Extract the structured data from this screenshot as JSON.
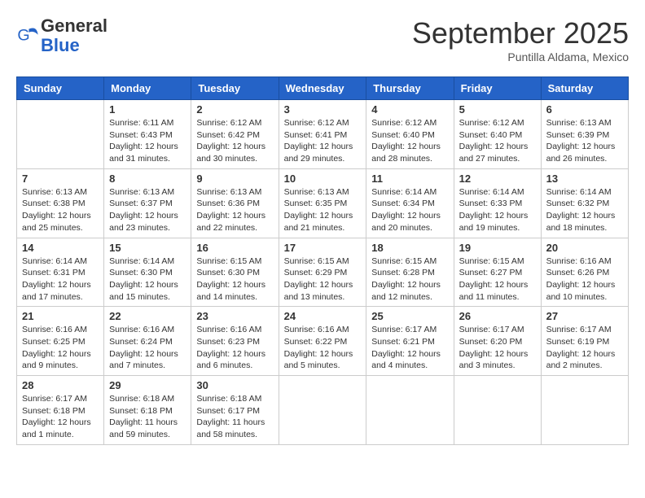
{
  "logo": {
    "general": "General",
    "blue": "Blue"
  },
  "header": {
    "month": "September 2025",
    "location": "Puntilla Aldama, Mexico"
  },
  "days_of_week": [
    "Sunday",
    "Monday",
    "Tuesday",
    "Wednesday",
    "Thursday",
    "Friday",
    "Saturday"
  ],
  "weeks": [
    [
      {
        "day": "",
        "info": ""
      },
      {
        "day": "1",
        "info": "Sunrise: 6:11 AM\nSunset: 6:43 PM\nDaylight: 12 hours\nand 31 minutes."
      },
      {
        "day": "2",
        "info": "Sunrise: 6:12 AM\nSunset: 6:42 PM\nDaylight: 12 hours\nand 30 minutes."
      },
      {
        "day": "3",
        "info": "Sunrise: 6:12 AM\nSunset: 6:41 PM\nDaylight: 12 hours\nand 29 minutes."
      },
      {
        "day": "4",
        "info": "Sunrise: 6:12 AM\nSunset: 6:40 PM\nDaylight: 12 hours\nand 28 minutes."
      },
      {
        "day": "5",
        "info": "Sunrise: 6:12 AM\nSunset: 6:40 PM\nDaylight: 12 hours\nand 27 minutes."
      },
      {
        "day": "6",
        "info": "Sunrise: 6:13 AM\nSunset: 6:39 PM\nDaylight: 12 hours\nand 26 minutes."
      }
    ],
    [
      {
        "day": "7",
        "info": "Sunrise: 6:13 AM\nSunset: 6:38 PM\nDaylight: 12 hours\nand 25 minutes."
      },
      {
        "day": "8",
        "info": "Sunrise: 6:13 AM\nSunset: 6:37 PM\nDaylight: 12 hours\nand 23 minutes."
      },
      {
        "day": "9",
        "info": "Sunrise: 6:13 AM\nSunset: 6:36 PM\nDaylight: 12 hours\nand 22 minutes."
      },
      {
        "day": "10",
        "info": "Sunrise: 6:13 AM\nSunset: 6:35 PM\nDaylight: 12 hours\nand 21 minutes."
      },
      {
        "day": "11",
        "info": "Sunrise: 6:14 AM\nSunset: 6:34 PM\nDaylight: 12 hours\nand 20 minutes."
      },
      {
        "day": "12",
        "info": "Sunrise: 6:14 AM\nSunset: 6:33 PM\nDaylight: 12 hours\nand 19 minutes."
      },
      {
        "day": "13",
        "info": "Sunrise: 6:14 AM\nSunset: 6:32 PM\nDaylight: 12 hours\nand 18 minutes."
      }
    ],
    [
      {
        "day": "14",
        "info": "Sunrise: 6:14 AM\nSunset: 6:31 PM\nDaylight: 12 hours\nand 17 minutes."
      },
      {
        "day": "15",
        "info": "Sunrise: 6:14 AM\nSunset: 6:30 PM\nDaylight: 12 hours\nand 15 minutes."
      },
      {
        "day": "16",
        "info": "Sunrise: 6:15 AM\nSunset: 6:30 PM\nDaylight: 12 hours\nand 14 minutes."
      },
      {
        "day": "17",
        "info": "Sunrise: 6:15 AM\nSunset: 6:29 PM\nDaylight: 12 hours\nand 13 minutes."
      },
      {
        "day": "18",
        "info": "Sunrise: 6:15 AM\nSunset: 6:28 PM\nDaylight: 12 hours\nand 12 minutes."
      },
      {
        "day": "19",
        "info": "Sunrise: 6:15 AM\nSunset: 6:27 PM\nDaylight: 12 hours\nand 11 minutes."
      },
      {
        "day": "20",
        "info": "Sunrise: 6:16 AM\nSunset: 6:26 PM\nDaylight: 12 hours\nand 10 minutes."
      }
    ],
    [
      {
        "day": "21",
        "info": "Sunrise: 6:16 AM\nSunset: 6:25 PM\nDaylight: 12 hours\nand 9 minutes."
      },
      {
        "day": "22",
        "info": "Sunrise: 6:16 AM\nSunset: 6:24 PM\nDaylight: 12 hours\nand 7 minutes."
      },
      {
        "day": "23",
        "info": "Sunrise: 6:16 AM\nSunset: 6:23 PM\nDaylight: 12 hours\nand 6 minutes."
      },
      {
        "day": "24",
        "info": "Sunrise: 6:16 AM\nSunset: 6:22 PM\nDaylight: 12 hours\nand 5 minutes."
      },
      {
        "day": "25",
        "info": "Sunrise: 6:17 AM\nSunset: 6:21 PM\nDaylight: 12 hours\nand 4 minutes."
      },
      {
        "day": "26",
        "info": "Sunrise: 6:17 AM\nSunset: 6:20 PM\nDaylight: 12 hours\nand 3 minutes."
      },
      {
        "day": "27",
        "info": "Sunrise: 6:17 AM\nSunset: 6:19 PM\nDaylight: 12 hours\nand 2 minutes."
      }
    ],
    [
      {
        "day": "28",
        "info": "Sunrise: 6:17 AM\nSunset: 6:18 PM\nDaylight: 12 hours\nand 1 minute."
      },
      {
        "day": "29",
        "info": "Sunrise: 6:18 AM\nSunset: 6:18 PM\nDaylight: 11 hours\nand 59 minutes."
      },
      {
        "day": "30",
        "info": "Sunrise: 6:18 AM\nSunset: 6:17 PM\nDaylight: 11 hours\nand 58 minutes."
      },
      {
        "day": "",
        "info": ""
      },
      {
        "day": "",
        "info": ""
      },
      {
        "day": "",
        "info": ""
      },
      {
        "day": "",
        "info": ""
      }
    ]
  ]
}
